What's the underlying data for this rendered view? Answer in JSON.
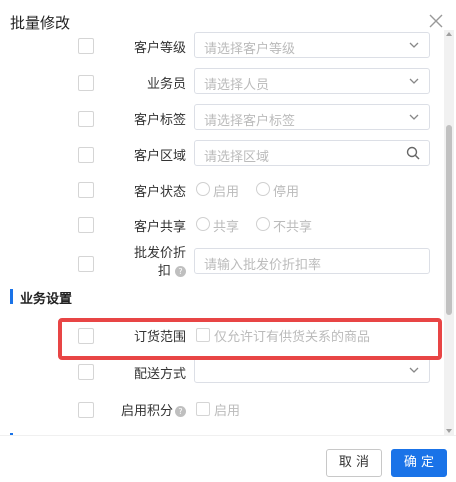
{
  "dialog": {
    "title": "批量修改",
    "close_icon": "close-icon"
  },
  "rows": {
    "customer_level": {
      "label": "客户等级",
      "placeholder": "请选择客户等级"
    },
    "salesperson": {
      "label": "业务员",
      "placeholder": "请选择人员"
    },
    "customer_tag": {
      "label": "客户标签",
      "placeholder": "请选择客户标签"
    },
    "customer_region": {
      "label": "客户区域",
      "placeholder": "请选择区域"
    },
    "customer_status": {
      "label": "客户状态",
      "option1": "启用",
      "option2": "停用"
    },
    "customer_share": {
      "label": "客户共享",
      "option1": "共享",
      "option2": "不共享"
    },
    "wholesale_discount": {
      "label_line1": "批发价折",
      "label_line2": "扣",
      "placeholder": "请输入批发价折扣率"
    }
  },
  "business_section": {
    "title": "业务设置",
    "order_scope": {
      "label": "订货范围",
      "option": "仅允许订有供货关系的商品"
    },
    "delivery_method": {
      "label": "配送方式",
      "value": ""
    },
    "enable_points": {
      "label": "启用积分",
      "option": "启用"
    }
  },
  "footer": {
    "cancel": "取 消",
    "confirm": "确 定"
  },
  "colors": {
    "primary": "#1a73e8",
    "highlight": "#e84545"
  }
}
